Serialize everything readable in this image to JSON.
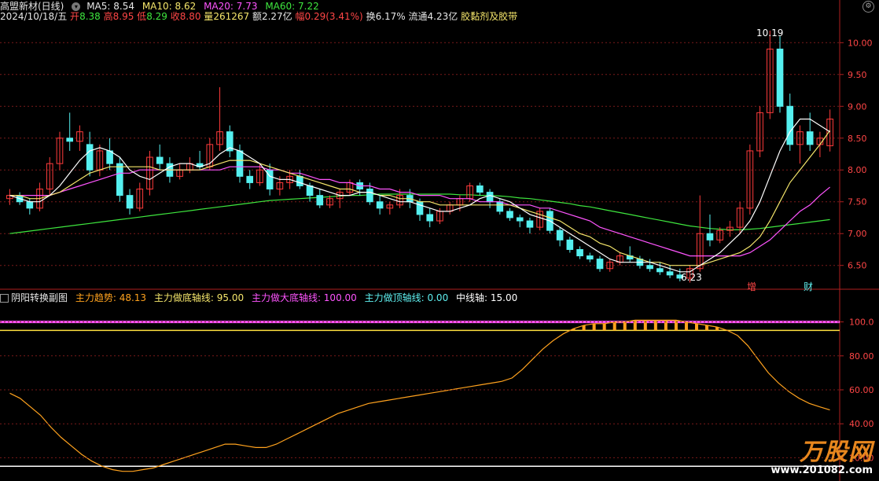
{
  "header": {
    "stock_name": "高盟新材(日线)",
    "ma5": "MA5: 8.54",
    "ma10": "MA10: 8.62",
    "ma20": "MA20: 7.73",
    "ma60": "MA60: 7.22",
    "date": "2024/10/18/五",
    "open_label": "开",
    "open": "8.38",
    "high_label": "高",
    "high": "8.95",
    "low_label": "低",
    "low": "8.29",
    "close_label": "收",
    "close": "8.80",
    "vol_label": "量",
    "vol": "261267",
    "amount": "额2.27亿",
    "change_label": "幅",
    "change": "0.29(3.41%)",
    "turnover": "换6.17%",
    "float": "流通4.23亿",
    "sector": "胶黏剂及胶带"
  },
  "price_axis": [
    "10.00",
    "9.50",
    "9.00",
    "8.50",
    "8.00",
    "7.50",
    "7.00",
    "6.50"
  ],
  "annotations": {
    "high": "10.19",
    "low": "6.23",
    "tag_zeng": "增",
    "tag_cai": "财"
  },
  "sub_header": {
    "title": "阴阳转换副图",
    "trend": "主力趋势: 48.13",
    "bottom": "主力做底轴线: 95.00",
    "big_bottom": "主力做大底轴线: 100.00",
    "top": "主力做顶轴线: 0.00",
    "mid": "中线轴: 15.00"
  },
  "sub_axis": [
    "100.0",
    "80.00",
    "60.00",
    "40.00",
    "20.00"
  ],
  "watermark": {
    "logo": "万股网",
    "url": "www.201082.com"
  },
  "colors": {
    "up": "#ff3b3b",
    "down": "#55f0f0",
    "ma5": "#ffffff",
    "ma10": "#f5e66b",
    "ma20": "#ff55ff",
    "ma60": "#3ee63e",
    "trend": "#ffa21e"
  },
  "chart_data": [
    {
      "type": "candlestick",
      "title": "高盟新材(日线)",
      "ylim": [
        6.2,
        10.3
      ],
      "ohlc": [
        [
          7.55,
          7.7,
          7.45,
          7.6
        ],
        [
          7.6,
          7.65,
          7.45,
          7.5
        ],
        [
          7.5,
          7.55,
          7.3,
          7.4
        ],
        [
          7.4,
          7.8,
          7.35,
          7.7
        ],
        [
          7.7,
          8.2,
          7.6,
          8.1
        ],
        [
          8.1,
          8.6,
          8.0,
          8.5
        ],
        [
          8.5,
          8.9,
          8.3,
          8.45
        ],
        [
          8.45,
          8.7,
          8.3,
          8.6
        ],
        [
          8.4,
          8.6,
          7.9,
          8.0
        ],
        [
          8.0,
          8.4,
          7.9,
          8.3
        ],
        [
          8.3,
          8.5,
          8.0,
          8.1
        ],
        [
          8.1,
          8.2,
          7.5,
          7.6
        ],
        [
          7.6,
          7.7,
          7.3,
          7.4
        ],
        [
          7.4,
          7.8,
          7.35,
          7.7
        ],
        [
          7.7,
          8.3,
          7.6,
          8.2
        ],
        [
          8.2,
          8.4,
          8.0,
          8.1
        ],
        [
          8.1,
          8.2,
          7.8,
          7.9
        ],
        [
          7.9,
          8.1,
          7.85,
          8.0
        ],
        [
          8.0,
          8.2,
          7.95,
          8.1
        ],
        [
          8.1,
          8.3,
          8.0,
          8.05
        ],
        [
          8.05,
          8.5,
          8.0,
          8.4
        ],
        [
          8.4,
          9.3,
          8.3,
          8.6
        ],
        [
          8.6,
          8.7,
          8.2,
          8.3
        ],
        [
          8.3,
          8.4,
          7.8,
          7.9
        ],
        [
          7.9,
          8.0,
          7.7,
          7.8
        ],
        [
          7.8,
          8.1,
          7.75,
          8.0
        ],
        [
          8.0,
          8.1,
          7.6,
          7.7
        ],
        [
          7.7,
          7.9,
          7.6,
          7.8
        ],
        [
          7.8,
          8.0,
          7.7,
          7.9
        ],
        [
          7.9,
          8.0,
          7.7,
          7.75
        ],
        [
          7.75,
          7.8,
          7.5,
          7.6
        ],
        [
          7.6,
          7.7,
          7.4,
          7.45
        ],
        [
          7.45,
          7.6,
          7.4,
          7.55
        ],
        [
          7.55,
          7.7,
          7.4,
          7.65
        ],
        [
          7.65,
          7.85,
          7.6,
          7.8
        ],
        [
          7.8,
          7.85,
          7.6,
          7.7
        ],
        [
          7.7,
          7.8,
          7.45,
          7.5
        ],
        [
          7.5,
          7.6,
          7.3,
          7.4
        ],
        [
          7.4,
          7.5,
          7.3,
          7.45
        ],
        [
          7.45,
          7.7,
          7.4,
          7.6
        ],
        [
          7.6,
          7.7,
          7.4,
          7.5
        ],
        [
          7.5,
          7.55,
          7.2,
          7.3
        ],
        [
          7.3,
          7.4,
          7.1,
          7.2
        ],
        [
          7.2,
          7.4,
          7.15,
          7.35
        ],
        [
          7.35,
          7.5,
          7.3,
          7.45
        ],
        [
          7.45,
          7.6,
          7.35,
          7.55
        ],
        [
          7.55,
          7.8,
          7.5,
          7.75
        ],
        [
          7.75,
          7.8,
          7.6,
          7.65
        ],
        [
          7.65,
          7.7,
          7.4,
          7.5
        ],
        [
          7.5,
          7.55,
          7.3,
          7.35
        ],
        [
          7.35,
          7.4,
          7.2,
          7.25
        ],
        [
          7.25,
          7.3,
          7.1,
          7.2
        ],
        [
          7.2,
          7.25,
          7.0,
          7.1
        ],
        [
          7.1,
          7.4,
          7.05,
          7.35
        ],
        [
          7.35,
          7.4,
          7.0,
          7.05
        ],
        [
          7.05,
          7.1,
          6.8,
          6.9
        ],
        [
          6.9,
          6.95,
          6.7,
          6.75
        ],
        [
          6.75,
          6.8,
          6.6,
          6.65
        ],
        [
          6.65,
          6.7,
          6.55,
          6.6
        ],
        [
          6.6,
          6.65,
          6.4,
          6.45
        ],
        [
          6.45,
          6.6,
          6.4,
          6.55
        ],
        [
          6.55,
          6.7,
          6.5,
          6.65
        ],
        [
          6.65,
          6.8,
          6.55,
          6.6
        ],
        [
          6.6,
          6.65,
          6.45,
          6.5
        ],
        [
          6.5,
          6.6,
          6.4,
          6.45
        ],
        [
          6.45,
          6.55,
          6.35,
          6.4
        ],
        [
          6.4,
          6.5,
          6.3,
          6.35
        ],
        [
          6.35,
          6.45,
          6.25,
          6.3
        ],
        [
          6.3,
          6.5,
          6.23,
          6.45
        ],
        [
          6.45,
          7.6,
          6.4,
          7.0
        ],
        [
          7.0,
          7.3,
          6.8,
          6.9
        ],
        [
          6.9,
          7.1,
          6.85,
          7.05
        ],
        [
          7.05,
          7.2,
          6.95,
          7.1
        ],
        [
          7.1,
          7.5,
          7.0,
          7.4
        ],
        [
          7.4,
          8.4,
          7.3,
          8.3
        ],
        [
          8.3,
          9.0,
          8.2,
          8.9
        ],
        [
          8.9,
          10.19,
          8.8,
          9.9
        ],
        [
          9.9,
          10.1,
          8.9,
          9.0
        ],
        [
          9.0,
          9.2,
          8.3,
          8.4
        ],
        [
          8.4,
          8.7,
          8.1,
          8.6
        ],
        [
          8.6,
          8.9,
          8.3,
          8.4
        ],
        [
          8.4,
          8.6,
          8.2,
          8.5
        ],
        [
          8.38,
          8.95,
          8.29,
          8.8
        ]
      ],
      "ma5": [
        7.6,
        7.55,
        7.5,
        7.5,
        7.6,
        7.75,
        7.95,
        8.15,
        8.3,
        8.35,
        8.3,
        8.2,
        8.0,
        7.9,
        7.85,
        7.95,
        8.05,
        8.1,
        8.1,
        8.05,
        8.1,
        8.25,
        8.35,
        8.3,
        8.2,
        8.1,
        7.9,
        7.85,
        7.85,
        7.8,
        7.75,
        7.7,
        7.65,
        7.6,
        7.6,
        7.65,
        7.65,
        7.6,
        7.55,
        7.5,
        7.5,
        7.45,
        7.4,
        7.35,
        7.35,
        7.4,
        7.45,
        7.55,
        7.6,
        7.55,
        7.5,
        7.4,
        7.3,
        7.25,
        7.2,
        7.1,
        7.0,
        6.9,
        6.8,
        6.7,
        6.6,
        6.55,
        6.55,
        6.55,
        6.55,
        6.5,
        6.45,
        6.4,
        6.4,
        6.5,
        6.6,
        6.7,
        6.85,
        7.0,
        7.2,
        7.5,
        7.9,
        8.3,
        8.6,
        8.8,
        8.8,
        8.7,
        8.6
      ],
      "ma10": [
        7.6,
        7.6,
        7.55,
        7.55,
        7.6,
        7.65,
        7.75,
        7.85,
        7.95,
        8.0,
        8.05,
        8.05,
        8.05,
        8.05,
        8.05,
        8.0,
        8.0,
        8.0,
        8.0,
        8.0,
        8.05,
        8.1,
        8.15,
        8.15,
        8.15,
        8.1,
        8.05,
        8.0,
        7.95,
        7.9,
        7.85,
        7.8,
        7.75,
        7.7,
        7.7,
        7.65,
        7.65,
        7.6,
        7.6,
        7.55,
        7.55,
        7.5,
        7.5,
        7.45,
        7.45,
        7.45,
        7.45,
        7.45,
        7.45,
        7.45,
        7.45,
        7.4,
        7.35,
        7.3,
        7.25,
        7.2,
        7.1,
        7.0,
        6.95,
        6.85,
        6.8,
        6.7,
        6.65,
        6.6,
        6.55,
        6.55,
        6.5,
        6.5,
        6.5,
        6.5,
        6.55,
        6.6,
        6.65,
        6.7,
        6.8,
        6.95,
        7.2,
        7.5,
        7.8,
        8.0,
        8.2,
        8.4,
        8.62
      ],
      "ma20": [
        7.6,
        7.6,
        7.6,
        7.6,
        7.6,
        7.65,
        7.7,
        7.75,
        7.8,
        7.85,
        7.9,
        7.95,
        7.95,
        8.0,
        8.0,
        8.0,
        8.0,
        8.0,
        8.0,
        8.0,
        8.0,
        8.0,
        8.05,
        8.05,
        8.05,
        8.05,
        8.0,
        8.0,
        7.95,
        7.95,
        7.9,
        7.85,
        7.85,
        7.8,
        7.8,
        7.75,
        7.75,
        7.7,
        7.7,
        7.65,
        7.65,
        7.6,
        7.6,
        7.6,
        7.55,
        7.55,
        7.55,
        7.5,
        7.5,
        7.5,
        7.45,
        7.45,
        7.45,
        7.4,
        7.4,
        7.35,
        7.3,
        7.25,
        7.2,
        7.1,
        7.05,
        7.0,
        6.95,
        6.9,
        6.85,
        6.8,
        6.75,
        6.7,
        6.65,
        6.65,
        6.65,
        6.65,
        6.65,
        6.65,
        6.7,
        6.8,
        6.9,
        7.05,
        7.2,
        7.35,
        7.45,
        7.6,
        7.73
      ],
      "ma60": [
        7.0,
        7.02,
        7.04,
        7.06,
        7.08,
        7.1,
        7.12,
        7.14,
        7.16,
        7.18,
        7.2,
        7.22,
        7.24,
        7.26,
        7.28,
        7.3,
        7.32,
        7.34,
        7.36,
        7.38,
        7.4,
        7.42,
        7.44,
        7.46,
        7.48,
        7.5,
        7.52,
        7.53,
        7.54,
        7.55,
        7.56,
        7.57,
        7.58,
        7.59,
        7.6,
        7.6,
        7.61,
        7.62,
        7.62,
        7.62,
        7.62,
        7.62,
        7.62,
        7.62,
        7.62,
        7.61,
        7.61,
        7.6,
        7.6,
        7.59,
        7.58,
        7.56,
        7.55,
        7.53,
        7.51,
        7.49,
        7.47,
        7.44,
        7.42,
        7.39,
        7.36,
        7.33,
        7.3,
        7.27,
        7.24,
        7.21,
        7.18,
        7.15,
        7.12,
        7.1,
        7.08,
        7.07,
        7.06,
        7.06,
        7.07,
        7.08,
        7.1,
        7.12,
        7.14,
        7.16,
        7.18,
        7.2,
        7.22
      ]
    },
    {
      "type": "line",
      "title": "阴阳转换副图",
      "ylim": [
        10,
        110
      ],
      "levels": [
        {
          "name": "主力做大底轴线",
          "value": 100
        },
        {
          "name": "主力做底轴线",
          "value": 95
        },
        {
          "name": "中线轴",
          "value": 15
        }
      ],
      "trend": [
        58,
        55,
        50,
        45,
        38,
        32,
        27,
        22,
        18,
        15,
        13,
        12,
        12,
        13,
        14,
        16,
        18,
        20,
        22,
        24,
        26,
        28,
        28,
        27,
        26,
        26,
        28,
        31,
        34,
        37,
        40,
        43,
        46,
        48,
        50,
        52,
        53,
        54,
        55,
        56,
        57,
        58,
        59,
        60,
        61,
        62,
        63,
        64,
        65,
        67,
        72,
        78,
        84,
        89,
        93,
        96,
        98,
        99,
        99,
        100,
        100,
        101,
        101,
        101,
        101,
        101,
        100,
        99,
        98,
        97,
        95,
        92,
        86,
        78,
        70,
        64,
        59,
        55,
        52,
        50,
        48.13
      ]
    }
  ]
}
